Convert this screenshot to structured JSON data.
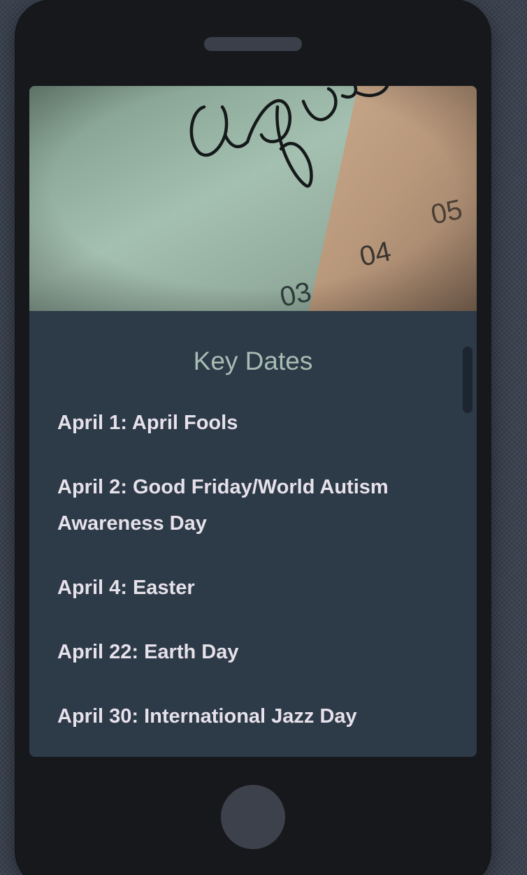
{
  "hero": {
    "image_caption_text": "april",
    "calendar_numbers": [
      "03",
      "04",
      "05"
    ]
  },
  "key_dates": {
    "title": "Key Dates",
    "items": [
      "April 1: April Fools",
      "April 2: Good Friday/World Autism Awareness Day",
      "April 4: Easter",
      "April 22: Earth Day",
      "April 30: International Jazz Day"
    ]
  },
  "colors": {
    "page_background": "#3b4350",
    "phone_body": "#17181c",
    "screen_background": "#2d3a47",
    "title_text": "#a8bcb4",
    "item_text": "#e6e1ea"
  }
}
